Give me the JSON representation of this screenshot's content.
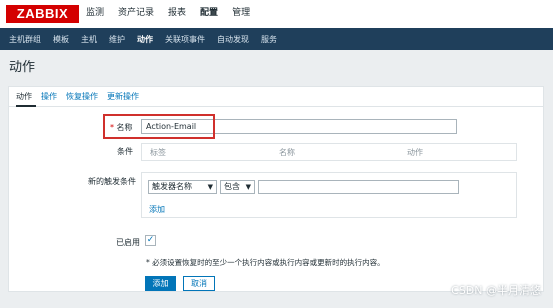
{
  "app": {
    "logo": "ZABBIX"
  },
  "topmenu": {
    "items": [
      {
        "label": "监测",
        "active": false
      },
      {
        "label": "资产记录",
        "active": false
      },
      {
        "label": "报表",
        "active": false
      },
      {
        "label": "配置",
        "active": true
      },
      {
        "label": "管理",
        "active": false
      }
    ]
  },
  "subnav": {
    "items": [
      {
        "label": "主机群组",
        "active": false
      },
      {
        "label": "模板",
        "active": false
      },
      {
        "label": "主机",
        "active": false
      },
      {
        "label": "维护",
        "active": false
      },
      {
        "label": "动作",
        "active": true
      },
      {
        "label": "关联项事件",
        "active": false
      },
      {
        "label": "自动发现",
        "active": false
      },
      {
        "label": "服务",
        "active": false
      }
    ]
  },
  "page": {
    "title": "动作"
  },
  "tabs": [
    {
      "label": "动作",
      "active": true
    },
    {
      "label": "操作",
      "active": false
    },
    {
      "label": "恢复操作",
      "active": false
    },
    {
      "label": "更新操作",
      "active": false
    }
  ],
  "form": {
    "name": {
      "required_mark": "*",
      "label": "名称",
      "value": "Action-Email"
    },
    "conditions": {
      "label": "条件",
      "headers": [
        "标签",
        "名称",
        "动作"
      ]
    },
    "new_condition": {
      "label": "新的触发条件",
      "type_select": "触发器名称",
      "operator_select": "包含",
      "value": "",
      "add_link": "添加"
    },
    "enabled": {
      "label": "已启用",
      "checked": true
    },
    "warning": "* 必须设置恢复时的至少一个执行内容或执行内容或更新时的执行内容。",
    "buttons": {
      "add": "添加",
      "cancel": "取消"
    }
  },
  "watermark": "CSDN @半月清悠",
  "colors": {
    "brand": "#d40000",
    "nav": "#1f3f5b",
    "link": "#0275b8",
    "highlight": "#d0302c"
  }
}
